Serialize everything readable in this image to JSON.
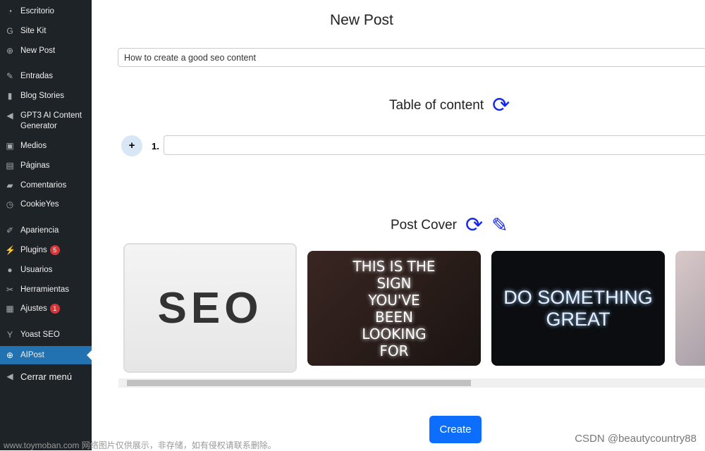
{
  "sidebar": {
    "items": [
      {
        "label": "Escritorio",
        "icon": "dashboard-icon"
      },
      {
        "label": "Site Kit",
        "icon": "google-g-icon"
      },
      {
        "label": "New Post",
        "icon": "plus-circle-icon"
      },
      {
        "label": "Entradas",
        "icon": "pin-icon"
      },
      {
        "label": "Blog Stories",
        "icon": "book-icon"
      },
      {
        "label": "GPT3 AI Content Generator",
        "icon": "megaphone-icon"
      },
      {
        "label": "Medios",
        "icon": "media-icon"
      },
      {
        "label": "Páginas",
        "icon": "pages-icon"
      },
      {
        "label": "Comentarios",
        "icon": "comment-icon"
      },
      {
        "label": "CookieYes",
        "icon": "cookie-icon"
      },
      {
        "label": "Apariencia",
        "icon": "brush-icon"
      },
      {
        "label": "Plugins",
        "icon": "plugin-icon",
        "badge": "5"
      },
      {
        "label": "Usuarios",
        "icon": "user-icon"
      },
      {
        "label": "Herramientas",
        "icon": "wrench-icon"
      },
      {
        "label": "Ajustes",
        "icon": "settings-icon",
        "badge": "1"
      },
      {
        "label": "Yoast SEO",
        "icon": "yoast-icon"
      },
      {
        "label": "AIPost",
        "icon": "plus-circle-icon",
        "active": true
      },
      {
        "label": "Cerrar menú",
        "icon": "collapse-icon"
      }
    ]
  },
  "main": {
    "title": "New Post",
    "post_title_value": "How to create a good seo content",
    "toc_heading": "Table of content",
    "toc_item_number": "1.",
    "toc_item_value": "",
    "cover_heading": "Post Cover",
    "images": [
      {
        "text": "SEO"
      },
      {
        "text": "THIS IS THE SIGN YOU'VE BEEN LOOKING FOR"
      },
      {
        "text": "DO SOMETHING GREAT"
      },
      {
        "text": ""
      }
    ],
    "create_label": "Create"
  },
  "accent": "#0d6efd",
  "icon_blue": "#1328ee",
  "watermark": {
    "left": "www.toymoban.com 网络图片仅供展示，非存储，如有侵权请联系删除。",
    "right": "CSDN @beautycountry88"
  }
}
